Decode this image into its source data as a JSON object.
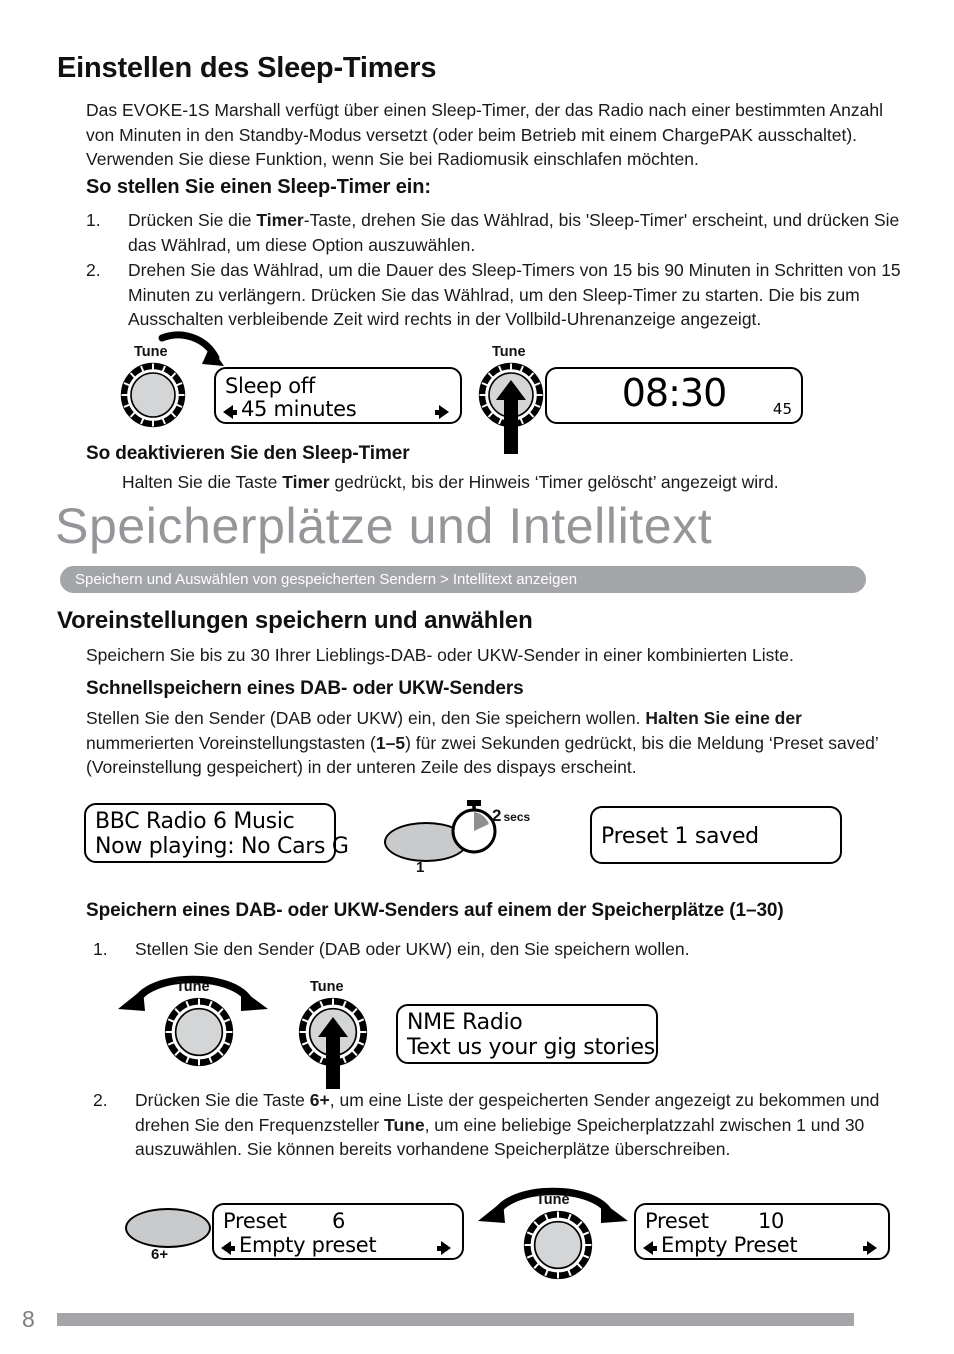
{
  "page": {
    "number": "8"
  },
  "sleep_timer": {
    "title": "Einstellen des Sleep-Timers",
    "intro": "Das EVOKE-1S Marshall verfügt über einen Sleep-Timer, der das Radio nach einer bestimmten Anzahl von Minuten in den Standby-Modus versetzt (oder beim Betrieb mit einem ChargePAK ausschaltet). Verwenden Sie diese Funktion, wenn Sie bei Radiomusik einschlafen möchten.",
    "set_heading": "So stellen Sie einen Sleep-Timer ein:",
    "steps": [
      {
        "num": "1.",
        "pre": "Drücken Sie die ",
        "bold": "Timer",
        "post": "-Taste, drehen Sie das Wählrad, bis 'Sleep-Timer' erscheint, und drücken Sie das Wählrad, um diese Option auszuwählen."
      },
      {
        "num": "2.",
        "pre": "Drehen Sie das Wählrad, um die Dauer des Sleep-Timers von 15 bis 90 Minuten in Schritten von 15 Minuten zu verlängern. Drücken Sie das Wählrad, um den Sleep-Timer zu starten. Die bis zum Ausschalten verbleibende Zeit wird rechts in der Vollbild-Uhrenanzeige angezeigt.",
        "bold": "",
        "post": ""
      }
    ],
    "deactivate_heading": "So deaktivieren Sie den Sleep-Timer",
    "deactivate_pre": "Halten Sie die Taste ",
    "deactivate_bold": "Timer",
    "deactivate_post": " gedrückt, bis der Hinweis ‘Timer gelöscht’ angezeigt wird."
  },
  "diagram_sleep": {
    "knob1_label": "Tune",
    "knob2_label": "Tune",
    "display1_line1": "Sleep off",
    "display1_line2": "45 minutes",
    "clock_time": "08:30",
    "clock_minutes": "45"
  },
  "chapter": {
    "title": "Speicherplätze und Intellitext",
    "banner_left": "Speichern und Auswählen von gespeicherten Sendern",
    "banner_sep": ">",
    "banner_right": "Intellitext anzeigen"
  },
  "presets": {
    "heading": "Voreinstellungen speichern und anwählen",
    "intro": "Speichern Sie bis zu 30 Ihrer Lieblings-DAB- oder UKW-Sender in einer kombinierten Liste.",
    "quick_heading": "Schnellspeichern eines DAB- oder UKW-Senders",
    "quick_text_a": "Stellen Sie den Sender (DAB oder UKW) ein, den Sie speichern wollen. ",
    "quick_text_b": "Halten Sie eine der",
    "quick_text_c": " nummerierten Voreinstellungstasten (",
    "quick_text_d": "1–5",
    "quick_text_e": ") für zwei Sekunden gedrückt, bis die Meldung ‘Preset saved’ (Voreinstellung gespeichert) in der unteren Zeile des dispays erscheint.",
    "store_heading": "Speichern eines DAB- oder UKW-Senders auf einem der Speicherplätze (1–30)",
    "store_step1_num": "1.",
    "store_step1": "Stellen Sie den Sender (DAB oder UKW) ein, den Sie speichern wollen.",
    "store_step2_num": "2.",
    "store_step2_a": "Drücken Sie die Taste ",
    "store_step2_b": "6+",
    "store_step2_c": ", um eine Liste der gespeicherten Sender angezeigt zu bekommen und drehen Sie den Frequenzsteller ",
    "store_step2_d": "Tune",
    "store_step2_e": ", um eine beliebige Speicherplatzzahl zwischen 1 und 30 auszuwählen. Sie können bereits vorhandene Speicherplätze überschreiben."
  },
  "diagram_quicksave": {
    "display_line1": "BBC Radio 6 Music",
    "display_line2": "Now playing: No Cars G",
    "button_label": "1",
    "secs_number": "2",
    "secs_unit": "secs",
    "result_line1": "Preset 1 saved"
  },
  "diagram_tune": {
    "knob1_label": "Tune",
    "knob2_label": "Tune",
    "display_line1": "NME Radio",
    "display_line2": "Text us your gig stories"
  },
  "diagram_preset_list": {
    "button_label": "6+",
    "display1_line1_label": "Preset",
    "display1_line1_value": "6",
    "display1_line2": "Empty preset",
    "knob_label": "Tune",
    "display2_line1_label": "Preset",
    "display2_line1_value": "10",
    "display2_line2": "Empty Preset"
  },
  "colors": {
    "grey_accent": "#a3a5a8",
    "chapter_grey": "#949699",
    "knob_fill": "#d4d5d7",
    "oval_fill": "#c9cacc"
  }
}
